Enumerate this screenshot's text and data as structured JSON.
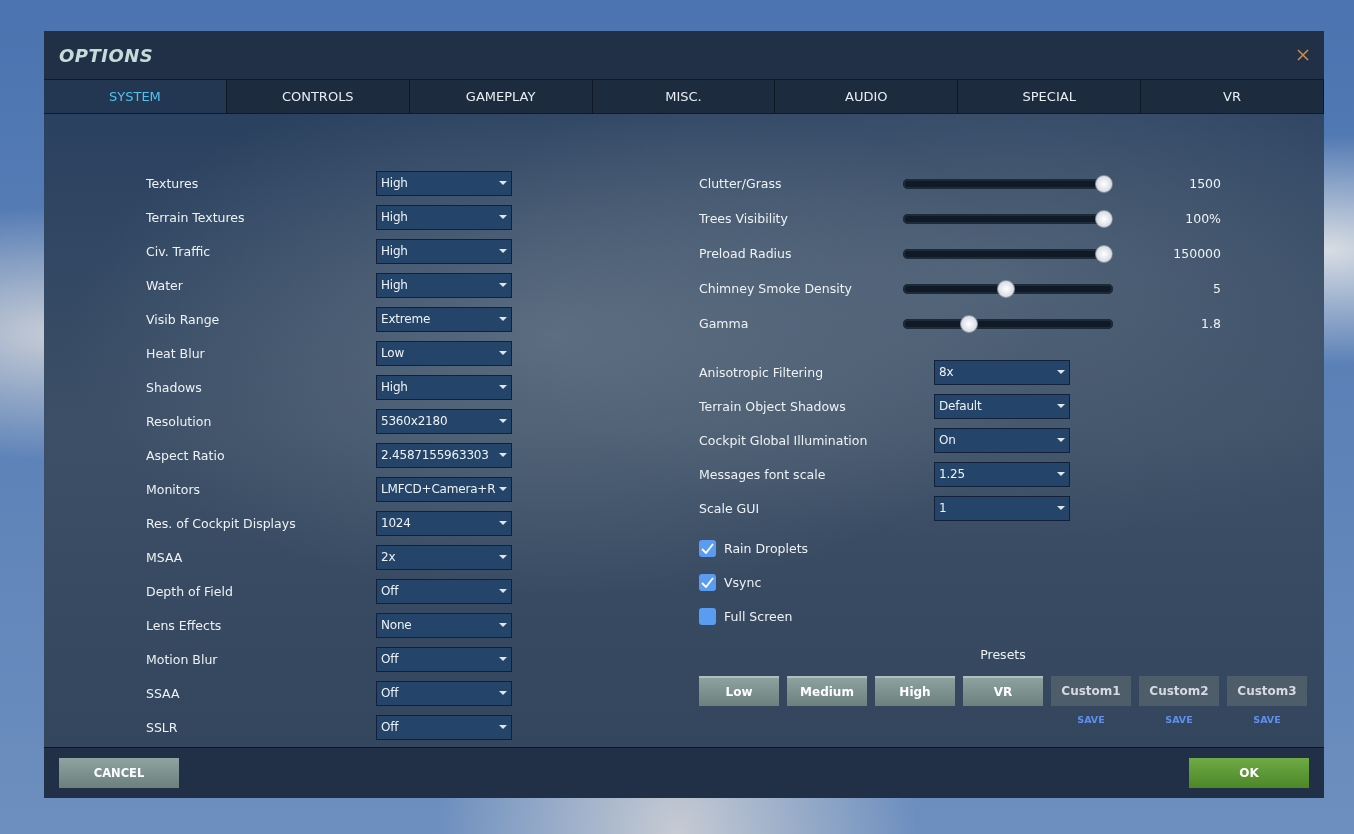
{
  "window": {
    "title": "OPTIONS"
  },
  "tabs": [
    {
      "label": "SYSTEM",
      "selected": true
    },
    {
      "label": "CONTROLS",
      "selected": false
    },
    {
      "label": "GAMEPLAY",
      "selected": false
    },
    {
      "label": "MISC.",
      "selected": false
    },
    {
      "label": "AUDIO",
      "selected": false
    },
    {
      "label": "SPECIAL",
      "selected": false
    },
    {
      "label": "VR",
      "selected": false
    }
  ],
  "left_settings": [
    {
      "label": "Textures",
      "value": "High"
    },
    {
      "label": "Terrain Textures",
      "value": "High"
    },
    {
      "label": "Civ. Traffic",
      "value": "High"
    },
    {
      "label": "Water",
      "value": "High"
    },
    {
      "label": "Visib Range",
      "value": "Extreme"
    },
    {
      "label": "Heat Blur",
      "value": "Low"
    },
    {
      "label": "Shadows",
      "value": "High"
    },
    {
      "label": "Resolution",
      "value": "5360x2180"
    },
    {
      "label": "Aspect Ratio",
      "value": "2.4587155963303"
    },
    {
      "label": "Monitors",
      "value": "LMFCD+Camera+R"
    },
    {
      "label": "Res. of Cockpit Displays",
      "value": "1024"
    },
    {
      "label": "MSAA",
      "value": "2x"
    },
    {
      "label": "Depth of Field",
      "value": "Off"
    },
    {
      "label": "Lens Effects",
      "value": "None"
    },
    {
      "label": "Motion Blur",
      "value": "Off"
    },
    {
      "label": "SSAA",
      "value": "Off"
    },
    {
      "label": "SSLR",
      "value": "Off"
    }
  ],
  "sliders": [
    {
      "label": "Clutter/Grass",
      "level": 1,
      "reading": "1500"
    },
    {
      "label": "Trees Visibility",
      "level": 1,
      "reading": "100%"
    },
    {
      "label": "Preload Radius",
      "level": 1,
      "reading": "150000"
    },
    {
      "label": "Chimney Smoke Density",
      "level": 0.5,
      "reading": "5"
    },
    {
      "label": "Gamma",
      "level": 0.31,
      "reading": "1.8"
    }
  ],
  "right_settings": [
    {
      "label": "Anisotropic Filtering",
      "value": "8x"
    },
    {
      "label": "Terrain Object Shadows",
      "value": "Default"
    },
    {
      "label": "Cockpit Global Illumination",
      "value": "On"
    },
    {
      "label": "Messages font scale",
      "value": "1.25"
    },
    {
      "label": "Scale GUI",
      "value": "1"
    }
  ],
  "checkboxes": [
    {
      "label": "Rain Droplets",
      "checked": true
    },
    {
      "label": "Vsync",
      "checked": true
    },
    {
      "label": "Full Screen",
      "checked": false
    }
  ],
  "presets": {
    "title": "Presets",
    "buttons": [
      {
        "label": "Low",
        "kind": "standard"
      },
      {
        "label": "Medium",
        "kind": "standard"
      },
      {
        "label": "High",
        "kind": "standard"
      },
      {
        "label": "VR",
        "kind": "standard"
      },
      {
        "label": "Custom1",
        "kind": "custom",
        "save": "SAVE"
      },
      {
        "label": "Custom2",
        "kind": "custom",
        "save": "SAVE"
      },
      {
        "label": "Custom3",
        "kind": "custom",
        "save": "SAVE"
      }
    ]
  },
  "footer": {
    "cancel": "CANCEL",
    "ok": "OK"
  }
}
